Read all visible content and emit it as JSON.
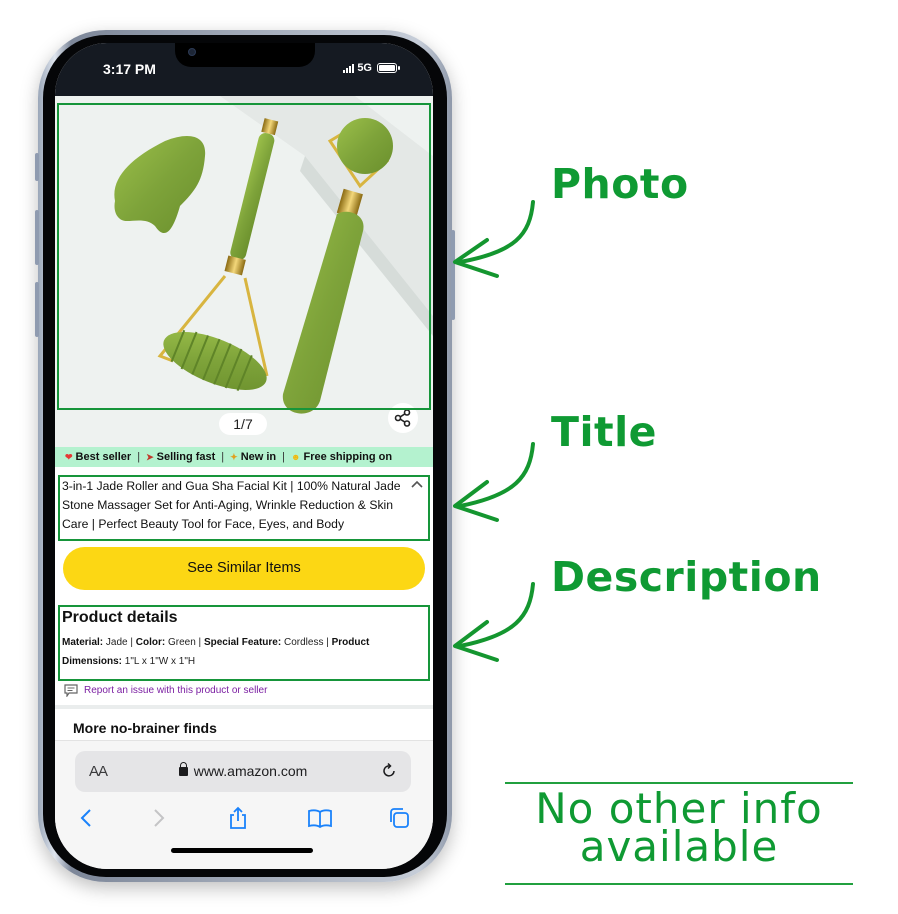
{
  "status_bar": {
    "time": "3:17 PM",
    "network": "5G"
  },
  "photo": {
    "alt": "Jade roller, gua sha stone and spiked jade roller on white surface",
    "counter": "1/7"
  },
  "badges": [
    {
      "icon": "heart-icon",
      "label": "Best seller"
    },
    {
      "icon": "rocket-icon",
      "label": "Selling fast"
    },
    {
      "icon": "party-icon",
      "label": "New in"
    },
    {
      "icon": "smiley-icon",
      "label": "Free shipping on"
    }
  ],
  "product": {
    "title": "3-in-1 Jade Roller and Gua Sha Facial Kit | 100% Natural Jade Stone Massager Set for Anti-Aging, Wrinkle Reduction & Skin Care | Perfect Beauty Tool for Face, Eyes, and Body",
    "similar_button": "See Similar Items",
    "details_heading": "Product details",
    "details": [
      {
        "key": "Material:",
        "value": "Jade"
      },
      {
        "key": "Color:",
        "value": "Green"
      },
      {
        "key": "Special Feature:",
        "value": "Cordless"
      },
      {
        "key": "Product Dimensions:",
        "value": "1\"L x 1\"W x 1\"H"
      }
    ],
    "report_link": "Report an issue with this product or seller",
    "more_heading": "More no-brainer finds"
  },
  "browser": {
    "text_size_label": "AA",
    "url": "www.amazon.com"
  },
  "annotations": {
    "photo_label": "Photo",
    "title_label": "Title",
    "description_label": "Description",
    "note_line1": "No other info",
    "note_line2": "available",
    "color": "#0f9a33"
  }
}
